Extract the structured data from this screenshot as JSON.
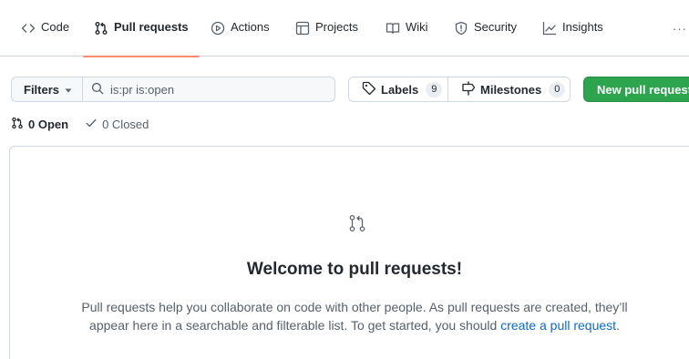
{
  "tabs": [
    {
      "label": "Code",
      "icon": "code-icon"
    },
    {
      "label": "Pull requests",
      "icon": "git-pull-request-icon",
      "active": true
    },
    {
      "label": "Actions",
      "icon": "play-icon"
    },
    {
      "label": "Projects",
      "icon": "table-icon"
    },
    {
      "label": "Wiki",
      "icon": "book-icon"
    },
    {
      "label": "Security",
      "icon": "shield-icon"
    },
    {
      "label": "Insights",
      "icon": "graph-icon"
    }
  ],
  "tab_more": "···",
  "filters": {
    "label": "Filters",
    "search_value": "is:pr is:open"
  },
  "labels": {
    "label": "Labels",
    "count": "9"
  },
  "milestones": {
    "label": "Milestones",
    "count": "0"
  },
  "new_pr": {
    "label": "New pull request"
  },
  "states": {
    "open": "0 Open",
    "closed": "0 Closed"
  },
  "blankslate": {
    "title": "Welcome to pull requests!",
    "text_before": "Pull requests help you collaborate on code with other people. As pull requests are created, they’ll appear here in a searchable and filterable list. To get started, you should ",
    "link": "create a pull request",
    "text_after": "."
  },
  "colors": {
    "accent": "#fd8c73",
    "primary_button": "#2da44e",
    "link": "#0969da",
    "muted": "#57606a",
    "border": "#d0d7de"
  }
}
